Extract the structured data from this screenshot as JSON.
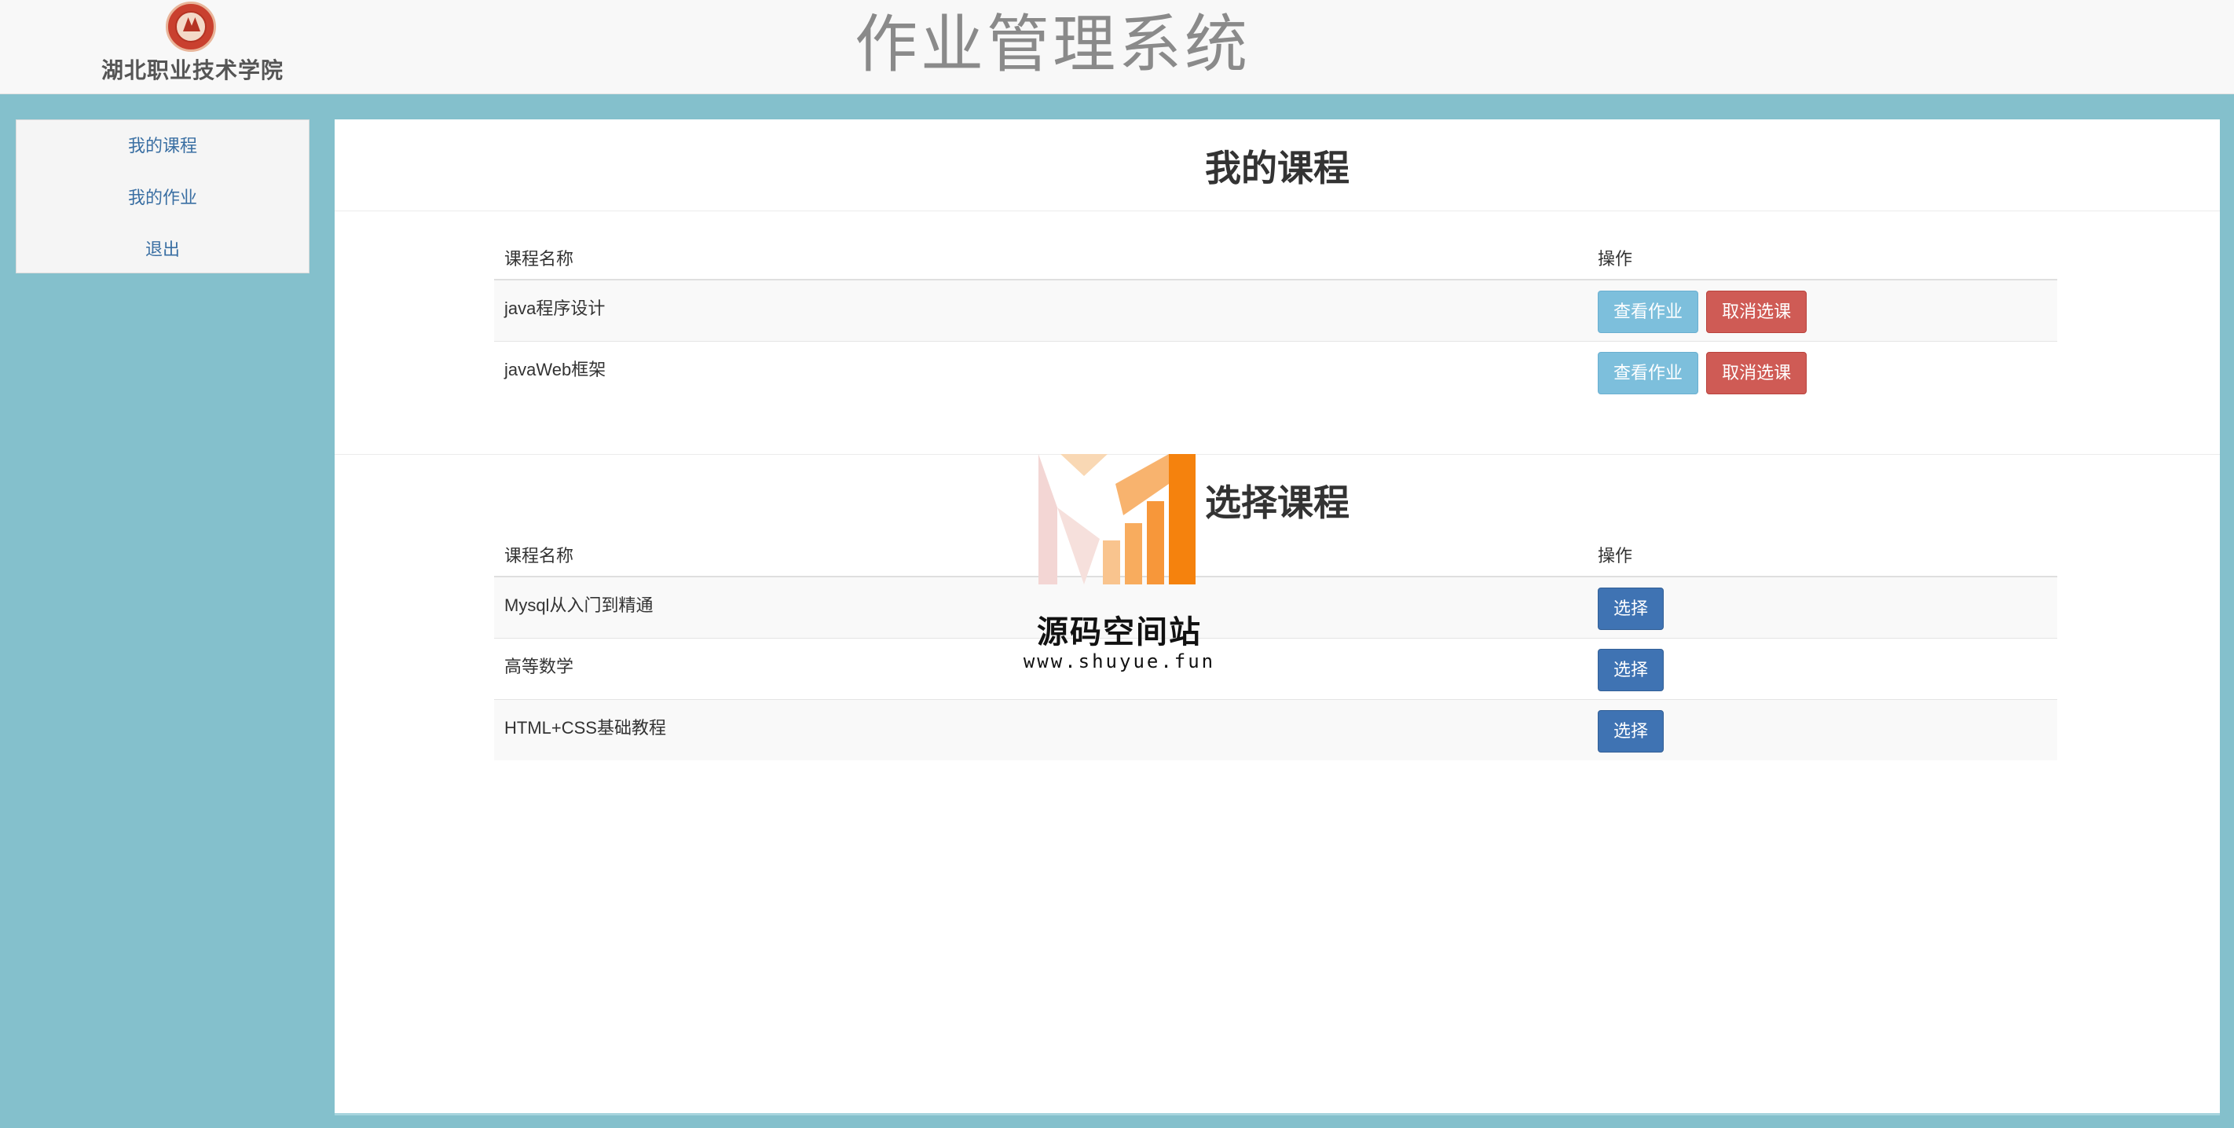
{
  "header": {
    "school_name": "湖北职业技术学院",
    "system_title": "作业管理系统"
  },
  "sidebar": {
    "items": [
      {
        "label": "我的课程"
      },
      {
        "label": "我的作业"
      },
      {
        "label": "退出"
      }
    ]
  },
  "my_courses": {
    "title": "我的课程",
    "columns": [
      "课程名称",
      "操作"
    ],
    "rows": [
      {
        "name": "java程序设计",
        "view_label": "查看作业",
        "cancel_label": "取消选课"
      },
      {
        "name": "javaWeb框架",
        "view_label": "查看作业",
        "cancel_label": "取消选课"
      }
    ]
  },
  "select_courses": {
    "title": "选择课程",
    "columns": [
      "课程名称",
      "操作"
    ],
    "rows": [
      {
        "name": "Mysql从入门到精通",
        "select_label": "选择"
      },
      {
        "name": "高等数学",
        "select_label": "选择"
      },
      {
        "name": "HTML+CSS基础教程",
        "select_label": "选择"
      }
    ]
  },
  "watermark": {
    "text": "源码空间站",
    "url": "www.shuyue.fun"
  },
  "colors": {
    "page_bg": "#84c0cc",
    "info": "#7dbfdc",
    "danger": "#cf5b55",
    "primary": "#3f73b3",
    "link": "#3a6fa3"
  }
}
